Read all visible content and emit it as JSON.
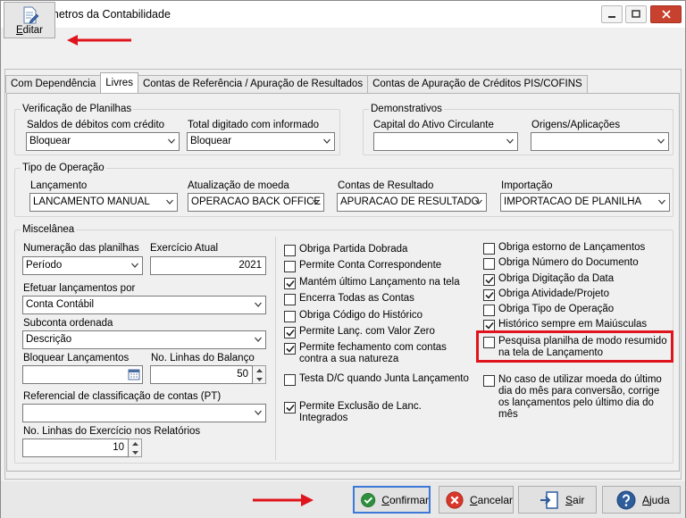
{
  "window": {
    "title": "Parâmetros da Contabilidade"
  },
  "toolbar": {
    "edit_label_u": "E",
    "edit_label_rest": "ditar"
  },
  "tabs": [
    "Com Dependência",
    "Livres",
    "Contas de Referência / Apuração de Resultados",
    "Contas de Apuração de Créditos PIS/COFINS"
  ],
  "verificacao": {
    "legend": "Verificação de Planilhas",
    "saldos_label": "Saldos de débitos com crédito",
    "saldos_value": "Bloquear",
    "total_label": "Total digitado com informado",
    "total_value": "Bloquear"
  },
  "demonstrativos": {
    "legend": "Demonstrativos",
    "capital_label": "Capital do Ativo Circulante",
    "capital_value": "",
    "origens_label": "Origens/Aplicações",
    "origens_value": ""
  },
  "tipo_operacao": {
    "legend": "Tipo de Operação",
    "lancamento_label": "Lançamento",
    "lancamento_value": "LANCAMENTO MANUAL",
    "atualizacao_label": "Atualização de moeda",
    "atualizacao_value": "OPERACAO BACK OFFICE",
    "contas_label": "Contas de Resultado",
    "contas_value": "APURACAO DE RESULTADO",
    "importacao_label": "Importação",
    "importacao_value": "IMPORTACAO DE PLANILHA"
  },
  "miscelanea": {
    "legend": "Miscelânea",
    "numeracao_label": "Numeração das planilhas",
    "numeracao_value": "Período",
    "exercicio_label": "Exercício Atual",
    "exercicio_value": "2021",
    "efetuar_label": "Efetuar lançamentos por",
    "efetuar_value": "Conta Contábil",
    "subconta_label": "Subconta ordenada",
    "subconta_value": "Descrição",
    "bloquear_label": "Bloquear Lançamentos",
    "bloquear_value": "",
    "linhas_balanco_label": "No. Linhas do Balanço",
    "linhas_balanco_value": "50",
    "referencial_label": "Referencial de classificação de contas (PT)",
    "referencial_value": "",
    "linhas_exercicio_label": "No. Linhas do Exercício nos Relatórios",
    "linhas_exercicio_value": "10"
  },
  "checks_col1": [
    {
      "label": "Obriga Partida Dobrada",
      "checked": false
    },
    {
      "label": "Permite Conta Correspondente",
      "checked": false
    },
    {
      "label": "Mantém último Lançamento na tela",
      "checked": true
    },
    {
      "label": "Encerra Todas as Contas",
      "checked": false
    },
    {
      "label": "Obriga Código do Histórico",
      "checked": false
    },
    {
      "label": "Permite Lanç. com Valor Zero",
      "checked": true
    },
    {
      "label": "Permite fechamento com contas contra a sua natureza",
      "checked": true
    },
    {
      "label": "Testa D/C quando Junta Lançamento",
      "checked": false
    },
    {
      "label": "Permite Exclusão de Lanc. Integrados",
      "checked": true
    }
  ],
  "checks_col2": [
    {
      "label": "Obriga estorno de Lançamentos",
      "checked": false
    },
    {
      "label": "Obriga Número do Documento",
      "checked": false
    },
    {
      "label": "Obriga Digitação da Data",
      "checked": true
    },
    {
      "label": "Obriga Atividade/Projeto",
      "checked": true
    },
    {
      "label": "Obriga Tipo de Operação",
      "checked": false
    },
    {
      "label": "Histórico sempre em Maiúsculas",
      "checked": true
    },
    {
      "label": "Pesquisa planilha de modo resumido na tela de Lançamento",
      "checked": false
    },
    {
      "label": "No caso de utilizar moeda do último dia do mês para conversão, corrige os lançamentos pelo último dia do mês",
      "checked": false
    }
  ],
  "buttons": {
    "confirmar_u": "C",
    "confirmar_rest": "onfirmar",
    "cancelar_u": "C",
    "cancelar_rest": "ancelar",
    "sair_u": "S",
    "sair_rest": "air",
    "ajuda_u": "A",
    "ajuda_rest": "juda"
  },
  "colors": {
    "accent": "#3b78d8",
    "highlight": "#e0141c",
    "arrow": "#e0141c"
  }
}
